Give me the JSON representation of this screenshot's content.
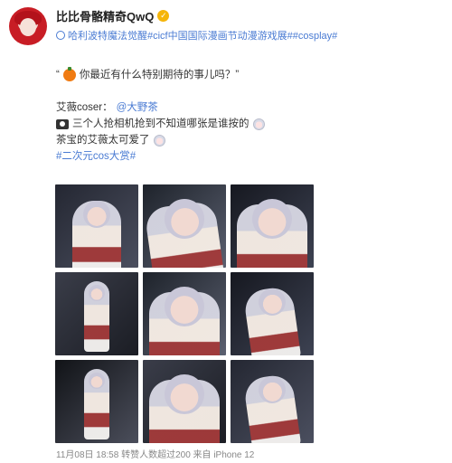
{
  "post": {
    "username": "比比骨骼精奇QwQ",
    "topics": "哈利波特魔法觉醒#cicf中国国际漫画节动漫游戏展##cosplay#",
    "quote": "“",
    "quote_text": "你最近有什么特别期待的事儿吗？”",
    "role_prefix": "艾薇coser：",
    "role_link": "@大野茶",
    "caption_text": "三个人抢相机抢到不知道哪张是谁按的",
    "comment_text": "茶宝的艾薇太可爱了",
    "tag": "#二次元cos大赏#",
    "footer": "11月08日 18:58 转赞人数超过200 来自 iPhone 12",
    "icons": [
      "verified-icon",
      "topic-icon",
      "pumpkin-emoji",
      "camera-icon",
      "face-emoji"
    ],
    "accent_color": "#4a7bd3"
  },
  "gallery": [
    {
      "variant": "bg-a"
    },
    {
      "variant": "bg-b closeup tilt"
    },
    {
      "variant": "bg-c closeup"
    },
    {
      "variant": "bg-d full"
    },
    {
      "variant": "bg-b closeup"
    },
    {
      "variant": "bg-c tilt"
    },
    {
      "variant": "bg-e full"
    },
    {
      "variant": "bg-d closeup"
    },
    {
      "variant": "bg-a tilt"
    }
  ]
}
